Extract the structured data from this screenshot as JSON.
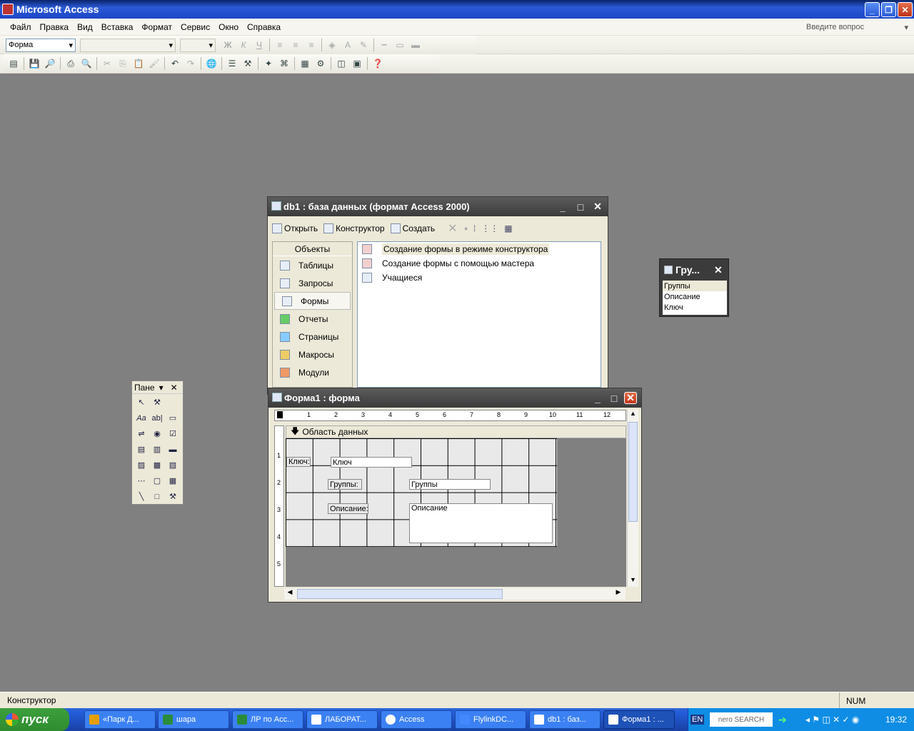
{
  "app": {
    "title": "Microsoft Access"
  },
  "menu": {
    "items": [
      "Файл",
      "Правка",
      "Вид",
      "Вставка",
      "Формат",
      "Сервис",
      "Окно",
      "Справка"
    ],
    "ask_placeholder": "Введите вопрос"
  },
  "formatting_toolbar": {
    "object_combo": "Форма"
  },
  "db_window": {
    "title": "db1 : база данных (формат Access 2000)",
    "toolbar": {
      "open": "Открыть",
      "design": "Конструктор",
      "create": "Создать"
    },
    "objects_header": "Объекты",
    "objects": [
      "Таблицы",
      "Запросы",
      "Формы",
      "Отчеты",
      "Страницы",
      "Макросы",
      "Модули"
    ],
    "selected_object": "Формы",
    "list": [
      "Создание формы в режиме конструктора",
      "Создание формы с помощью мастера",
      "Учащиеся"
    ]
  },
  "form_window": {
    "title": "Форма1 : форма",
    "section": "Область данных",
    "ruler_h": [
      "1",
      "2",
      "3",
      "4",
      "5",
      "6",
      "7",
      "8",
      "9",
      "10",
      "11",
      "12"
    ],
    "ruler_v": [
      "1",
      "2",
      "3",
      "4",
      "5"
    ],
    "controls": {
      "key_label": "Ключ:",
      "key_field": "Ключ",
      "groups_label": "Группы:",
      "groups_field": "Группы",
      "desc_label": "Описание:",
      "desc_field": "Описание"
    }
  },
  "toolbox": {
    "title": "Пане"
  },
  "field_list": {
    "title": "Гру...",
    "fields": [
      "Группы",
      "Описание",
      "Ключ"
    ]
  },
  "status": {
    "text": "Конструктор",
    "num": "NUM"
  },
  "taskbar": {
    "start": "пуск",
    "tasks": [
      "«Парк Д...",
      "шара",
      "ЛР по Acc...",
      "ЛАБОРАТ...",
      "Access",
      "FlylinkDC...",
      "db1 : баз...",
      "Форма1 : ..."
    ],
    "lang": "EN",
    "nero": "nero SEARCH",
    "clock": "19:32"
  }
}
